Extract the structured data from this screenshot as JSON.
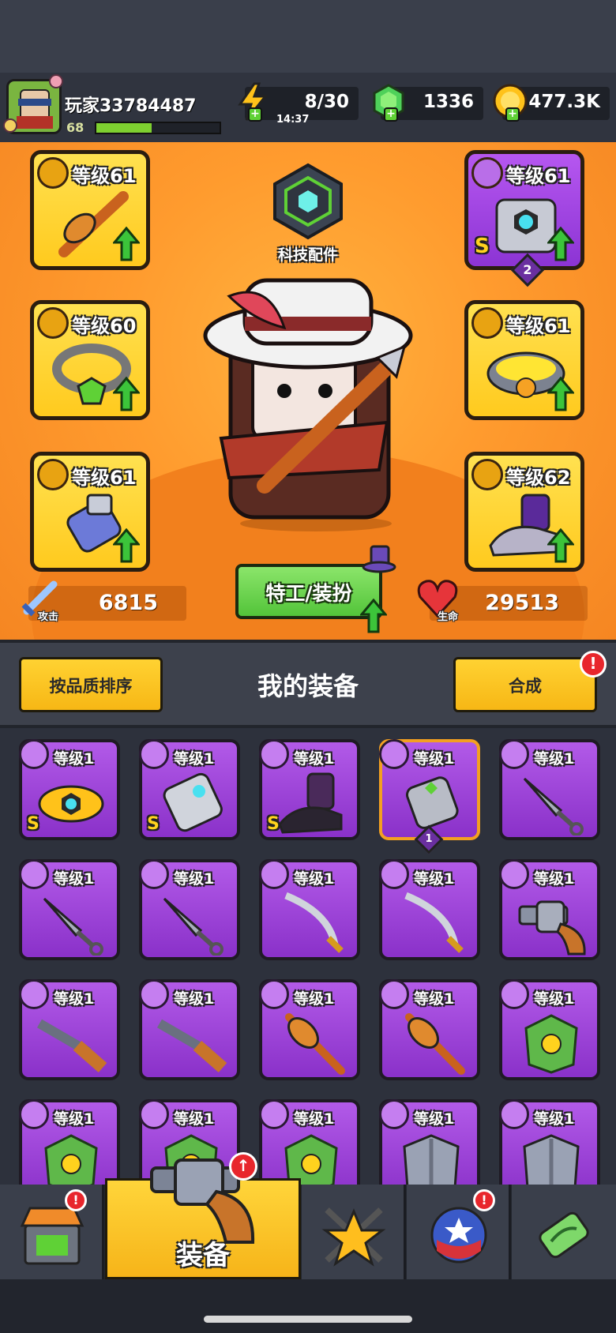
{
  "player": {
    "name": "玩家33784487",
    "level": "68",
    "xp_fraction": 0.45
  },
  "resources": {
    "energy": "8/30",
    "energy_timer": "14:37",
    "gems": "1336",
    "coins": "477.3K"
  },
  "equipment_slots": {
    "weapon": {
      "level_label": "等级61",
      "icon": "weapon-icon",
      "item": "spear-item"
    },
    "necklace": {
      "level_label": "等级60",
      "icon": "necklace-icon",
      "item": "gem-necklace-item"
    },
    "gloves": {
      "level_label": "等级61",
      "icon": "glove-icon",
      "item": "gauntlet-item"
    },
    "armor": {
      "level_label": "等级61",
      "icon": "armor-icon",
      "item": "mech-armor-item",
      "rank": "S",
      "stars": "2"
    },
    "belt": {
      "level_label": "等级61",
      "icon": "belt-icon",
      "item": "star-belt-item"
    },
    "boots": {
      "level_label": "等级62",
      "icon": "boot-icon",
      "item": "sneaker-item"
    }
  },
  "tech": {
    "label": "科技配件"
  },
  "stats": {
    "attack_label": "攻击",
    "attack_value": "6815",
    "hp_label": "生命",
    "hp_value": "29513"
  },
  "costume_button": "特工/装扮",
  "inventory_header": {
    "sort_button": "按品质排序",
    "title": "我的装备",
    "merge_button": "合成",
    "merge_alert": "!"
  },
  "inventory": [
    {
      "level": "等级1",
      "slot_icon": "belt-icon",
      "item": "mech-belt-item",
      "rank": "S"
    },
    {
      "level": "等级1",
      "slot_icon": "glove-icon",
      "item": "mech-glove-item",
      "rank": "S"
    },
    {
      "level": "等级1",
      "slot_icon": "boot-icon",
      "item": "dark-boot-item",
      "rank": "S"
    },
    {
      "level": "等级1",
      "slot_icon": "glove-icon",
      "item": "gray-glove-item",
      "selected": true,
      "stars": "1"
    },
    {
      "level": "等级1",
      "slot_icon": "weapon-icon",
      "item": "kunai-item"
    },
    {
      "level": "等级1",
      "slot_icon": "weapon-icon",
      "item": "kunai-item"
    },
    {
      "level": "等级1",
      "slot_icon": "weapon-icon",
      "item": "kunai-item"
    },
    {
      "level": "等级1",
      "slot_icon": "weapon-icon",
      "item": "katana-item"
    },
    {
      "level": "等级1",
      "slot_icon": "weapon-icon",
      "item": "katana-item"
    },
    {
      "level": "等级1",
      "slot_icon": "weapon-icon",
      "item": "revolver-item"
    },
    {
      "level": "等级1",
      "slot_icon": "weapon-icon",
      "item": "shotgun-item"
    },
    {
      "level": "等级1",
      "slot_icon": "weapon-icon",
      "item": "shotgun-item"
    },
    {
      "level": "等级1",
      "slot_icon": "weapon-icon",
      "item": "spear-item"
    },
    {
      "level": "等级1",
      "slot_icon": "weapon-icon",
      "item": "spear-item"
    },
    {
      "level": "等级1",
      "slot_icon": "armor-icon",
      "item": "leaf-armor-item"
    },
    {
      "level": "等级1",
      "slot_icon": "armor-icon",
      "item": "leaf-armor-item"
    },
    {
      "level": "等级1",
      "slot_icon": "armor-icon",
      "item": "leaf-armor-item"
    },
    {
      "level": "等级1",
      "slot_icon": "armor-icon",
      "item": "leaf-armor-item"
    },
    {
      "level": "等级1",
      "slot_icon": "armor-icon",
      "item": "steel-armor-item"
    },
    {
      "level": "等级1",
      "slot_icon": "armor-icon",
      "item": "steel-armor-item"
    }
  ],
  "tabs": [
    {
      "id": "shop",
      "icon": "shop-icon",
      "alert": "!"
    },
    {
      "id": "equipment",
      "icon": "revolver-icon",
      "label": "装备",
      "active": true
    },
    {
      "id": "talent",
      "icon": "star-crossed-swords-icon"
    },
    {
      "id": "skills",
      "icon": "star-orb-icon",
      "alert": "!"
    },
    {
      "id": "evolution",
      "icon": "dna-capsule-icon"
    }
  ],
  "colors": {
    "hero_bg": "#ff9b2e",
    "gold_slot": "#ffd232",
    "purple_slot": "#a447e0",
    "accent_green": "#5fd136",
    "alert_red": "#e8262c"
  }
}
